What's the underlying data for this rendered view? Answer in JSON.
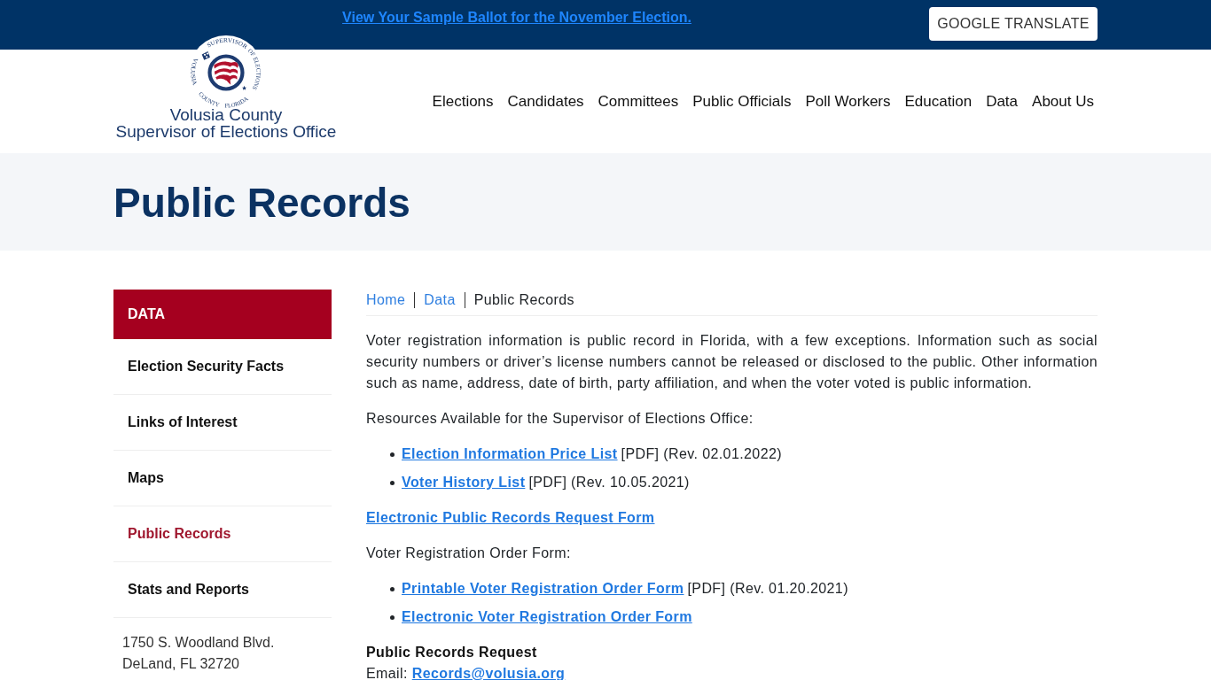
{
  "top_bar": {
    "announcement": "View Your Sample Ballot for the November Election.",
    "translate_button": "GOOGLE TRANSLATE"
  },
  "header": {
    "logo": {
      "ring_top": [
        "SUPERVISOR",
        "OF ELECTIONS"
      ],
      "ring_bottom": [
        "VOLUSIA",
        "COUNTY",
        "FLORIDA"
      ],
      "line_1": "Volusia County",
      "line_2": "Supervisor of Elections Office"
    },
    "nav": [
      {
        "label": "Elections"
      },
      {
        "label": "Candidates"
      },
      {
        "label": "Committees"
      },
      {
        "label": "Public Officials"
      },
      {
        "label": "Poll Workers"
      },
      {
        "label": "Education"
      },
      {
        "label": "Data"
      },
      {
        "label": "About Us"
      }
    ]
  },
  "page_title": "Public Records",
  "sidebar": {
    "heading": "DATA",
    "items": [
      {
        "label": "Election Security Facts",
        "selected": false
      },
      {
        "label": "Links of Interest",
        "selected": false
      },
      {
        "label": "Maps",
        "selected": false
      },
      {
        "label": "Public Records",
        "selected": true
      },
      {
        "label": "Stats and Reports",
        "selected": false
      }
    ],
    "address": [
      "1750 S. Woodland Blvd.",
      "DeLand, FL 32720"
    ]
  },
  "content": {
    "breadcrumb": [
      {
        "label": "Home",
        "kind": "link"
      },
      {
        "label": "Data",
        "kind": "link"
      },
      {
        "label": "Public Records",
        "kind": "current"
      }
    ],
    "blocks": [
      {
        "kind": "paragraph",
        "text": "Voter registration information is public record in Florida, with a few exceptions. Information such as social security numbers or driver’s license numbers cannot be released or disclosed to the public. Other information such as name, address, date of birth, party affiliation, and when the voter voted is public information."
      },
      {
        "kind": "paragraph",
        "text": "Resources Available for the Supervisor of Elections Office:"
      },
      {
        "kind": "list",
        "items": [
          {
            "link": "Election Information Price List",
            "note": "[PDF] (Rev. 02.01.2022)"
          },
          {
            "link": "Voter History List",
            "note": "[PDF] (Rev. 10.05.2021)"
          }
        ]
      },
      {
        "kind": "link",
        "text": "Electronic Public Records Request Form"
      },
      {
        "kind": "paragraph",
        "text": "Voter Registration Order Form:"
      },
      {
        "kind": "list",
        "items": [
          {
            "link": "Printable Voter Registration Order Form",
            "note": "[PDF] (Rev. 01.20.2021)"
          },
          {
            "link": "Electronic Voter Registration Order Form"
          }
        ]
      },
      {
        "kind": "contact",
        "heading": "Public Records Request",
        "label": "Email:",
        "link": "Records@volusia.org"
      }
    ]
  }
}
